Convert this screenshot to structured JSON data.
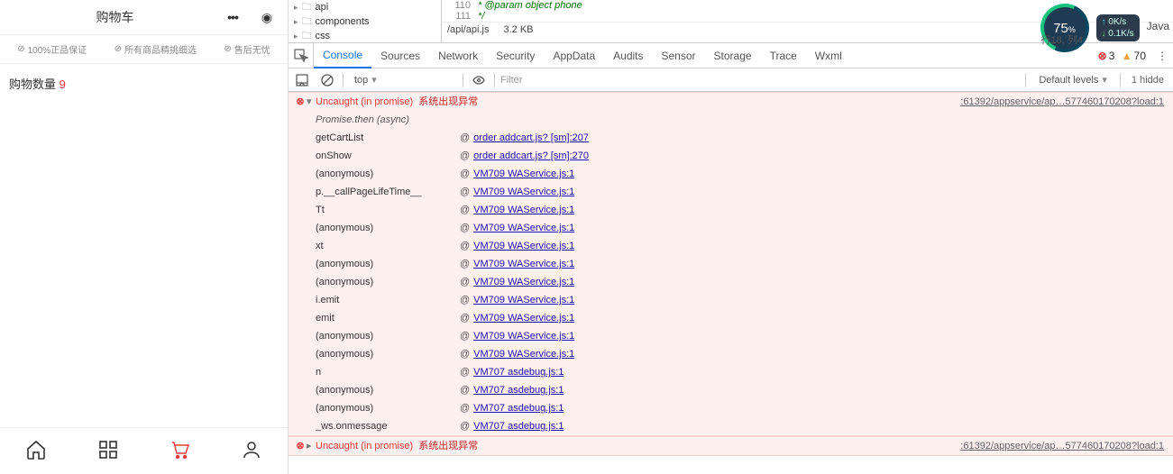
{
  "app": {
    "title": "购物车",
    "promos": [
      "100%正品保证",
      "所有商品精挑细选",
      "售后无忧"
    ],
    "cart_label": "购物数量",
    "cart_count": "9",
    "tabs": [
      "home",
      "grid",
      "cart",
      "user"
    ]
  },
  "code_peek": {
    "tree": [
      {
        "icon": "▸",
        "folder": true,
        "name": "api"
      },
      {
        "icon": "▸",
        "folder": true,
        "name": "components"
      },
      {
        "icon": "▸",
        "folder": true,
        "name": "css"
      }
    ],
    "lines": [
      {
        "num": "110",
        "text": "* @param object phone"
      },
      {
        "num": "111",
        "text": "*/"
      }
    ],
    "status_path": "/api/api.js",
    "status_size": "3.2 KB",
    "status_pos": "行18, 列4",
    "status_lang": "Java"
  },
  "tabs": {
    "items": [
      "Console",
      "Sources",
      "Network",
      "Security",
      "AppData",
      "Audits",
      "Sensor",
      "Storage",
      "Trace",
      "Wxml"
    ],
    "active": "Console",
    "err_count": "3",
    "warn_count": "70"
  },
  "toolbar": {
    "context": "top",
    "filter_placeholder": "Filter",
    "levels_label": "Default levels",
    "hidden_label": "1 hidde"
  },
  "errors": [
    {
      "expanded": true,
      "uncaught": "Uncaught (in promise)",
      "message": "系统出现异常",
      "source": ":61392/appservice/ap…577460170208?load:1",
      "async_label": "Promise.then (async)",
      "stack": [
        {
          "fn": "getCartList",
          "link": "order addcart.js? [sm]:207"
        },
        {
          "fn": "onShow",
          "link": "order addcart.js? [sm]:270"
        },
        {
          "fn": "(anonymous)",
          "link": "VM709 WAService.js:1"
        },
        {
          "fn": "p.__callPageLifeTime__",
          "link": "VM709 WAService.js:1"
        },
        {
          "fn": "Tt",
          "link": "VM709 WAService.js:1"
        },
        {
          "fn": "(anonymous)",
          "link": "VM709 WAService.js:1"
        },
        {
          "fn": "xt",
          "link": "VM709 WAService.js:1"
        },
        {
          "fn": "(anonymous)",
          "link": "VM709 WAService.js:1"
        },
        {
          "fn": "(anonymous)",
          "link": "VM709 WAService.js:1"
        },
        {
          "fn": "i.emit",
          "link": "VM709 WAService.js:1"
        },
        {
          "fn": "emit",
          "link": "VM709 WAService.js:1"
        },
        {
          "fn": "(anonymous)",
          "link": "VM709 WAService.js:1"
        },
        {
          "fn": "(anonymous)",
          "link": "VM709 WAService.js:1"
        },
        {
          "fn": "n",
          "link": "VM707 asdebug.js:1"
        },
        {
          "fn": "(anonymous)",
          "link": "VM707 asdebug.js:1"
        },
        {
          "fn": "(anonymous)",
          "link": "VM707 asdebug.js:1"
        },
        {
          "fn": "_ws.onmessage",
          "link": "VM707 asdebug.js:1"
        }
      ]
    },
    {
      "expanded": false,
      "uncaught": "Uncaught (in promise)",
      "message": "系统出现异常",
      "source": ":61392/appservice/ap…577460170208?load:1"
    }
  ],
  "netwidget": {
    "percent": "75",
    "up": "0K/s",
    "down": "0.1K/s"
  }
}
